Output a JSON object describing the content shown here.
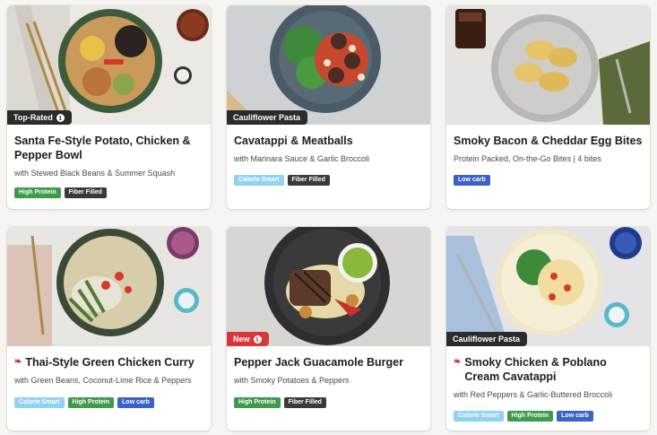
{
  "colors": {
    "high_protein": "#3f9a4c",
    "fiber_filled": "#3a3a3a",
    "calorie_smart": "#8fd3f2",
    "low_carb": "#3a62c9",
    "tag_dark": "#2b2b2b",
    "tag_new": "#d8373a"
  },
  "cards": [
    {
      "tag": "Top-Rated",
      "title": "Santa Fe-Style Potato, Chicken & Pepper Bowl",
      "subtitle": "with Stewed Black Beans & Summer Squash",
      "badges": [
        "High Protein",
        "Fiber Filled"
      ]
    },
    {
      "tag": "Cauliflower Pasta",
      "title": "Cavatappi & Meatballs",
      "subtitle": "with Marinara Sauce & Garlic Broccoli",
      "badges": [
        "Calorie Smart",
        "Fiber Filled"
      ]
    },
    {
      "title": "Smoky Bacon & Cheddar Egg Bites",
      "subtitle": "Protein Packed, On-the-Go Bites | 4 bites",
      "badges": [
        "Low carb"
      ]
    },
    {
      "title": "Thai-Style Green Chicken Curry",
      "subtitle": "with Green Beans, Coconut-Lime Rice & Peppers",
      "badges": [
        "Calorie Smart",
        "High Protein",
        "Low carb"
      ]
    },
    {
      "tag": "New",
      "title": "Pepper Jack Guacamole Burger",
      "subtitle": "with Smoky Potatoes & Peppers",
      "badges": [
        "High Protein",
        "Fiber Filled"
      ]
    },
    {
      "tag": "Cauliflower Pasta",
      "title": "Smoky Chicken & Poblano Cream Cavatappi",
      "subtitle": "with Red Peppers & Garlic-Buttered Broccoli",
      "badges": [
        "Calorie Smart",
        "High Protein",
        "Low carb"
      ]
    }
  ]
}
